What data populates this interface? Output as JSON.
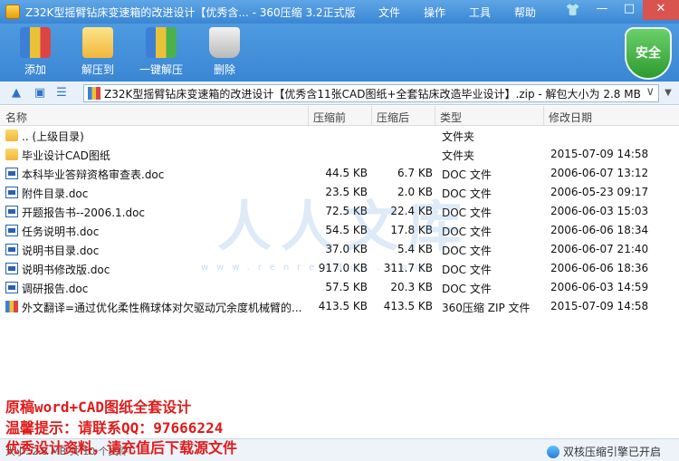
{
  "titlebar": {
    "title": "Z32K型摇臂钻床变速箱的改进设计【优秀含... - 360压缩 3.2正式版",
    "menu": [
      "文件",
      "操作",
      "工具",
      "帮助"
    ]
  },
  "toolbar": {
    "items": [
      {
        "label": "添加",
        "icon": "add-archive-icon"
      },
      {
        "label": "解压到",
        "icon": "extract-to-icon"
      },
      {
        "label": "一键解压",
        "icon": "one-click-extract-icon"
      },
      {
        "label": "删除",
        "icon": "trash-icon"
      }
    ],
    "shield_label": "安全"
  },
  "address": {
    "path": "Z32K型摇臂钻床变速箱的改进设计【优秀含11张CAD图纸+全套钻床改造毕业设计】.zip - 解包大小为 2.8 MB"
  },
  "columns": [
    "名称",
    "压缩前",
    "压缩后",
    "类型",
    "修改日期"
  ],
  "rows": [
    {
      "name": ".. (上级目录)",
      "size": "",
      "psize": "",
      "type": "文件夹",
      "date": "",
      "icon": "folder"
    },
    {
      "name": "毕业设计CAD图纸",
      "size": "",
      "psize": "",
      "type": "文件夹",
      "date": "2015-07-09 14:58",
      "icon": "folder"
    },
    {
      "name": "本科毕业答辩资格审查表.doc",
      "size": "44.5 KB",
      "psize": "6.7 KB",
      "type": "DOC 文件",
      "date": "2006-06-07 13:12",
      "icon": "doc"
    },
    {
      "name": "附件目录.doc",
      "size": "23.5 KB",
      "psize": "2.0 KB",
      "type": "DOC 文件",
      "date": "2006-05-23 09:17",
      "icon": "doc"
    },
    {
      "name": "开题报告书--2006.1.doc",
      "size": "72.5 KB",
      "psize": "22.4 KB",
      "type": "DOC 文件",
      "date": "2006-06-03 15:03",
      "icon": "doc"
    },
    {
      "name": "任务说明书.doc",
      "size": "54.5 KB",
      "psize": "17.8 KB",
      "type": "DOC 文件",
      "date": "2006-06-06 18:34",
      "icon": "doc"
    },
    {
      "name": "说明书目录.doc",
      "size": "37.0 KB",
      "psize": "5.4 KB",
      "type": "DOC 文件",
      "date": "2006-06-07 21:40",
      "icon": "doc"
    },
    {
      "name": "说明书修改版.doc",
      "size": "917.0 KB",
      "psize": "311.7 KB",
      "type": "DOC 文件",
      "date": "2006-06-06 18:36",
      "icon": "doc"
    },
    {
      "name": "调研报告.doc",
      "size": "57.5 KB",
      "psize": "20.3 KB",
      "type": "DOC 文件",
      "date": "2006-06-03 14:59",
      "icon": "doc"
    },
    {
      "name": "外文翻译=通过优化柔性椭球体对欠驱动冗余度机械臂的...",
      "size": "413.5 KB",
      "psize": "413.5 KB",
      "type": "360压缩 ZIP 文件",
      "date": "2015-07-09 14:58",
      "icon": "zip"
    }
  ],
  "watermark": {
    "text": "人人文库",
    "url": "www.renrendoc.com"
  },
  "promo": [
    "原稿word+CAD图纸全套设计",
    "温馨提示：请联系QQ：97666224",
    "优秀设计资料，请充值后下载源文件"
  ],
  "status": {
    "left": "大小: 2.8 MB 共 10 个文件",
    "right": "双核压缩引擎已开启"
  }
}
